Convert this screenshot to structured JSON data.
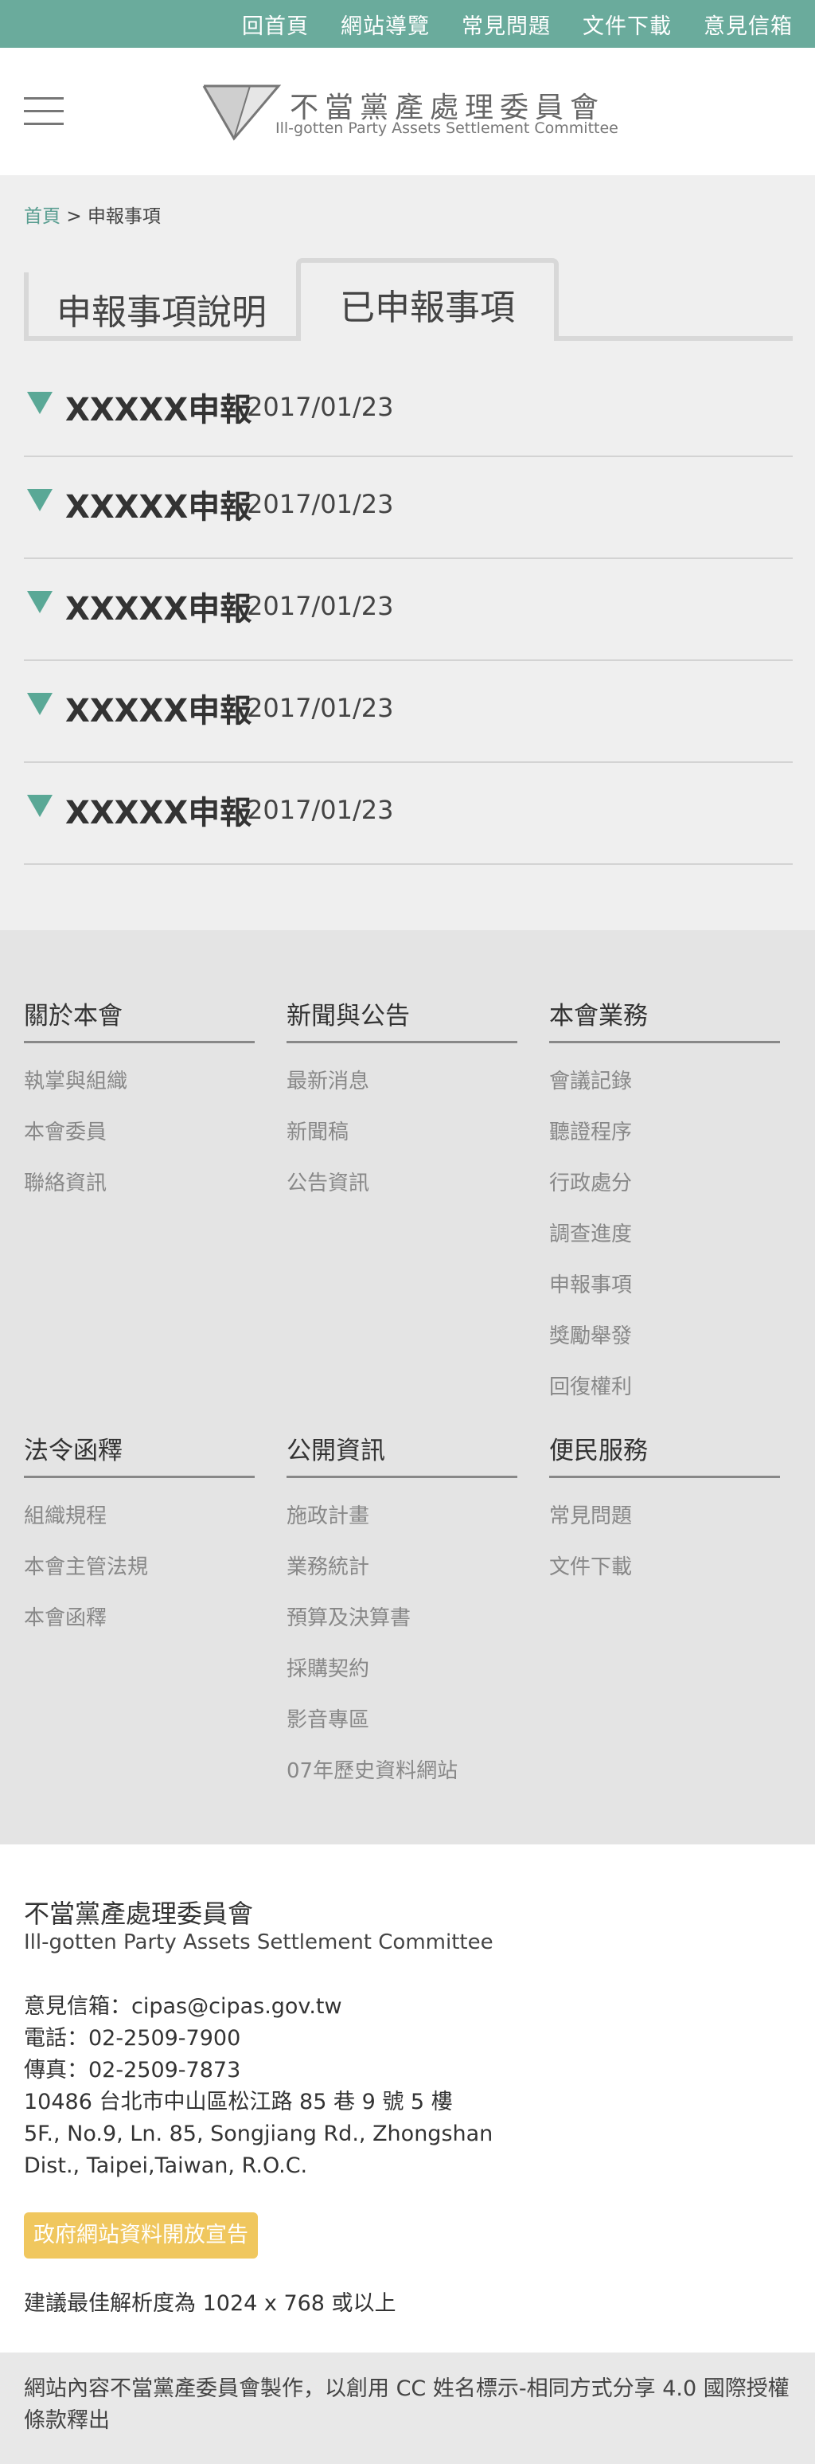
{
  "topnav": [
    "回首頁",
    "網站導覽",
    "常見問題",
    "文件下載",
    "意見信箱"
  ],
  "header": {
    "menu_icon": "hamburger-icon",
    "logo_icon": "triangle-logo-icon",
    "logo_zh": "不當黨產處理委員會",
    "logo_en": "Ill-gotten Party Assets Settlement Committee"
  },
  "breadcrumb": {
    "home": "首頁",
    "separator": ">",
    "current": "申報事項"
  },
  "tabs": [
    "申報事項說明",
    "已申報事項"
  ],
  "active_tab": 1,
  "items": [
    {
      "title": "XXXXX申報",
      "date": "2017/01/23"
    },
    {
      "title": "XXXXX申報",
      "date": "2017/01/23"
    },
    {
      "title": "XXXXX申報",
      "date": "2017/01/23"
    },
    {
      "title": "XXXXX申報",
      "date": "2017/01/23"
    },
    {
      "title": "XXXXX申報",
      "date": "2017/01/23"
    }
  ],
  "footer_nav": [
    {
      "heading": "關於本會",
      "links": [
        "執掌與組織",
        "本會委員",
        "聯絡資訊"
      ]
    },
    {
      "heading": "新聞與公告",
      "links": [
        "最新消息",
        "新聞稿",
        "公告資訊"
      ]
    },
    {
      "heading": "本會業務",
      "links": [
        "會議記錄",
        "聽證程序",
        "行政處分",
        "調查進度",
        "申報事項",
        "獎勵舉發",
        "回復權利"
      ]
    },
    {
      "heading": "法令函釋",
      "links": [
        "組織規程",
        "本會主管法規",
        "本會函釋"
      ]
    },
    {
      "heading": "公開資訊",
      "links": [
        "施政計畫",
        "業務統計",
        "預算及決算書",
        "採購契約",
        "影音專區",
        "07年歷史資料網站"
      ]
    },
    {
      "heading": "便民服務",
      "links": [
        "常見問題",
        "文件下載"
      ]
    }
  ],
  "contact": {
    "org": "不當黨產處理委員會",
    "org_en": "Ill-gotten Party Assets Settlement Committee",
    "lines": [
      "意見信箱：cipas@cipas.gov.tw",
      "電話：02-2509-7900",
      "傳真：02-2509-7873",
      "10486 台北市中山區松江路 85 巷 9 號 5 樓",
      "5F., No.9, Ln. 85, Songjiang Rd., Zhongshan",
      "Dist., Taipei,Taiwan, R.O.C."
    ],
    "open_data": "政府網站資料開放宣告",
    "resolution": "建議最佳解析度為 1024 x 768 或以上"
  },
  "license": "網站內容不當黨產委員會製作，以創用 CC 姓名標示-相同方式分享 4.0 國際授權條款釋出",
  "colors": {
    "topbar": "#6aab9c",
    "accent": "#5aa896",
    "open_data_button": "#f0c75e"
  }
}
